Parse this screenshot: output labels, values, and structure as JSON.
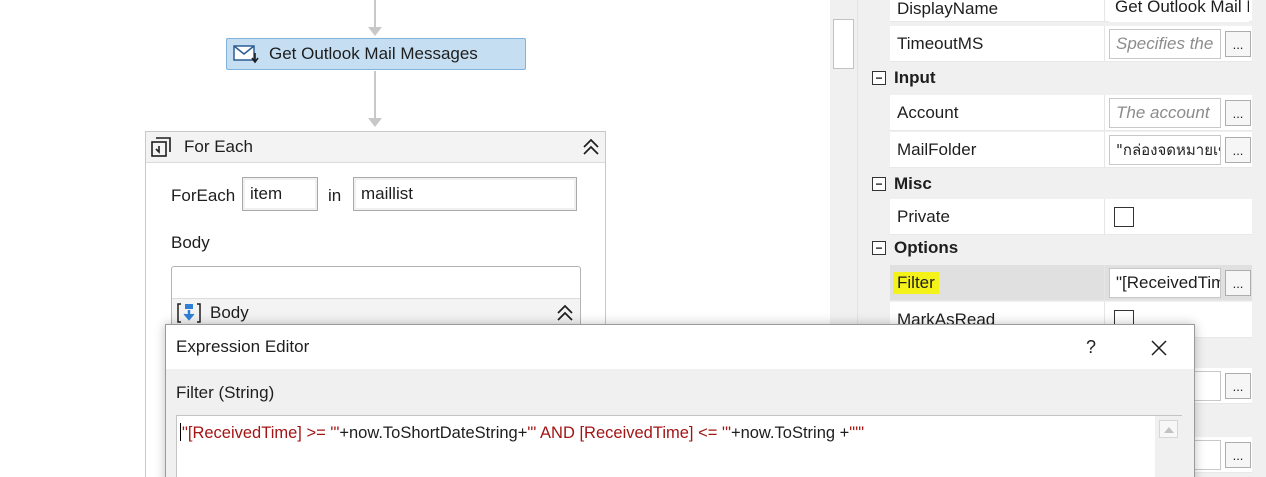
{
  "designer": {
    "activity": {
      "label": "Get Outlook Mail Messages"
    },
    "foreach": {
      "title": "For Each",
      "foreach_label": "ForEach",
      "item_value": "item",
      "in_label": "in",
      "collection_value": "maillist",
      "body_label": "Body",
      "body_inner_title": "Body"
    }
  },
  "properties": {
    "rows_top": [
      {
        "name": "DisplayName",
        "value": "Get Outlook Mail Messages",
        "kind": "plain"
      },
      {
        "name": "TimeoutMS",
        "value": "Specifies the",
        "kind": "placeholder"
      }
    ],
    "categories": [
      {
        "label": "Input",
        "rows": [
          {
            "name": "Account",
            "value": "The account",
            "kind": "placeholder"
          },
          {
            "name": "MailFolder",
            "value": "\"กล่องจดหมายเข้า\"",
            "kind": "text"
          }
        ]
      },
      {
        "label": "Misc",
        "rows": [
          {
            "name": "Private",
            "kind": "checkbox"
          }
        ]
      },
      {
        "label": "Options",
        "rows": [
          {
            "name": "Filter",
            "value": "\"[ReceivedTime] >= '\"",
            "kind": "text",
            "selected": true
          },
          {
            "name": "MarkAsRead",
            "kind": "checkbox"
          }
        ]
      }
    ],
    "toggle_symbol": "−",
    "ellipsis": "..."
  },
  "dialog": {
    "title": "Expression Editor",
    "help": "?",
    "field_label": "Filter (String)",
    "expression_tokens": [
      {
        "t": "\"[ReceivedTime] >= '\"",
        "c": "str"
      },
      {
        "t": "+now.ToShortDateString+",
        "c": "op"
      },
      {
        "t": "\"' AND [ReceivedTime] <= '\"",
        "c": "str"
      },
      {
        "t": "+now.ToString +",
        "c": "op"
      },
      {
        "t": "\"'\"",
        "c": "str"
      }
    ]
  },
  "colors": {
    "activity_fill": "#c5def1",
    "activity_border": "#7fb2dd",
    "string_literal": "#a31515",
    "highlight": "#f5f21a"
  }
}
